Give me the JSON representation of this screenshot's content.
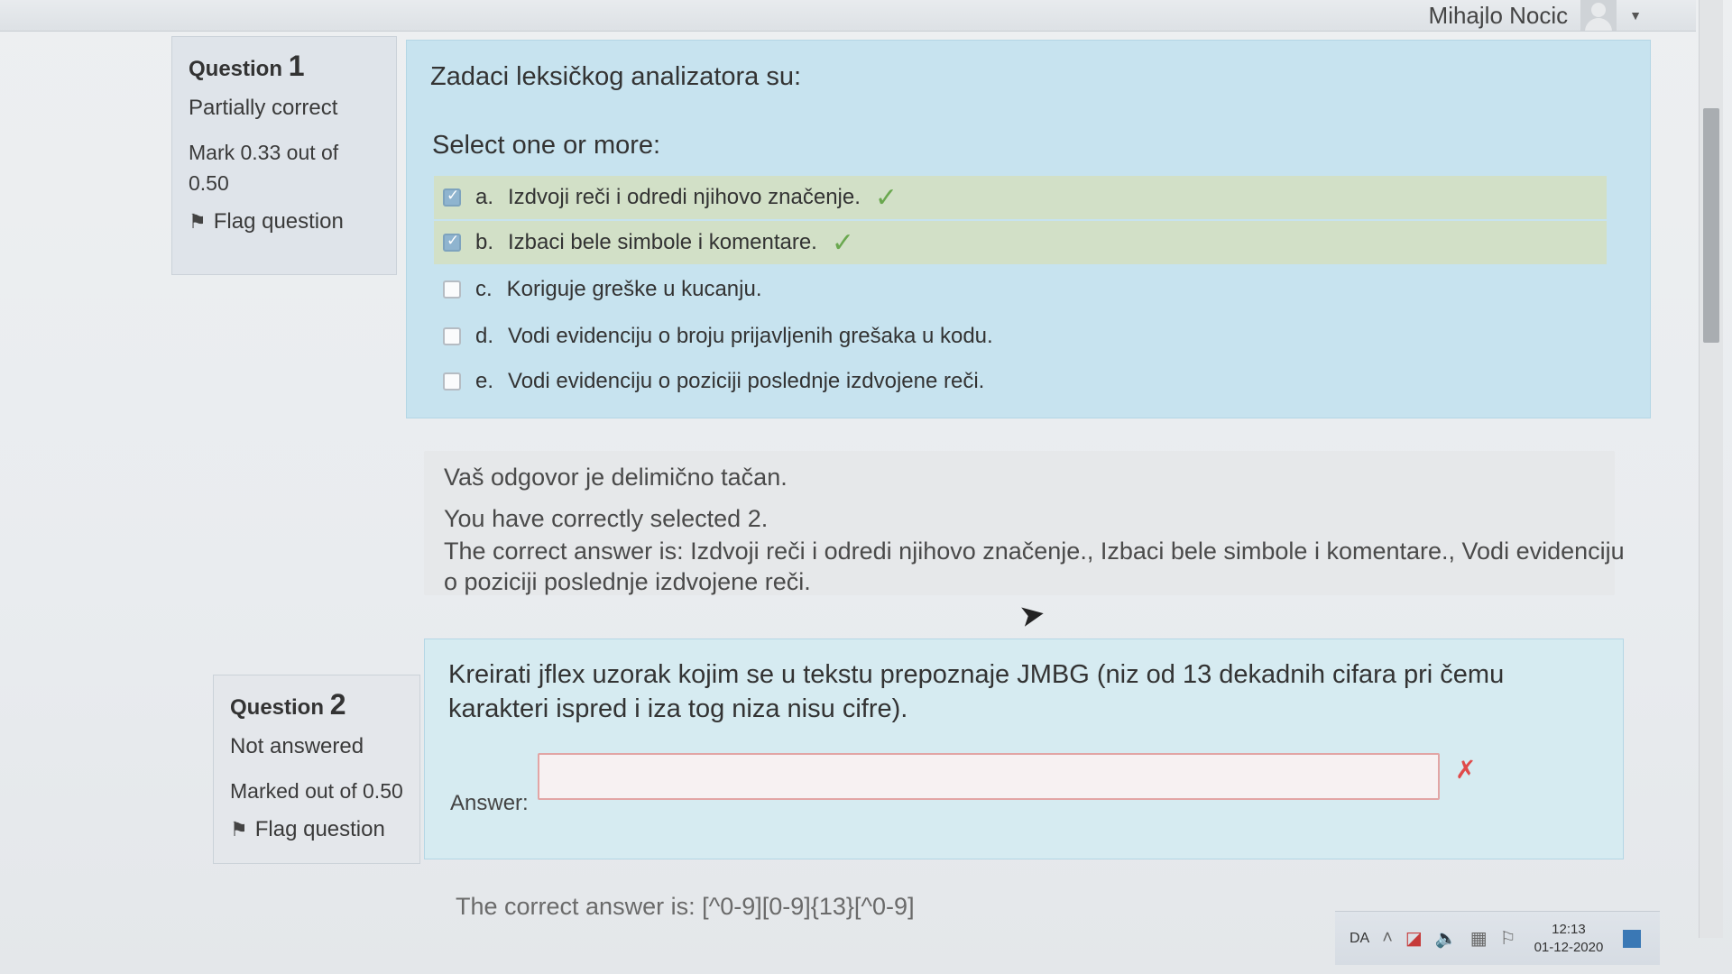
{
  "header": {
    "user_name": "Mihajlo Nocic"
  },
  "question1": {
    "label": "Question",
    "number": "1",
    "state": "Partially correct",
    "grade_line1": "Mark 0.33 out of",
    "grade_line2": "0.50",
    "flag_label": "Flag question",
    "prompt": "Zadaci leksičkog analizatora su:",
    "select_label": "Select one or more:",
    "options": [
      {
        "letter": "a.",
        "text": "Izdvoji reči i odredi njihovo značenje.",
        "checked": true,
        "correct": true
      },
      {
        "letter": "b.",
        "text": "Izbaci bele simbole i komentare.",
        "checked": true,
        "correct": true
      },
      {
        "letter": "c.",
        "text": "Koriguje greške u kucanju.",
        "checked": false,
        "correct": false
      },
      {
        "letter": "d.",
        "text": "Vodi evidenciju o broju prijavljenih grešaka u kodu.",
        "checked": false,
        "correct": false
      },
      {
        "letter": "e.",
        "text": "Vodi evidenciju o poziciji poslednje izdvojene reči.",
        "checked": false,
        "correct": false
      }
    ],
    "feedback": {
      "summary": "Vaš odgovor je delimično tačan.",
      "selected": "You have correctly selected 2.",
      "correct_answer_line1": "The correct answer is: Izdvoji reči i odredi njihovo značenje., Izbaci bele simbole i komentare., Vodi evidenciju",
      "correct_answer_line2": "o poziciji poslednje izdvojene reči."
    }
  },
  "question2": {
    "label": "Question",
    "number": "2",
    "state": "Not answered",
    "grade": "Marked out of 0.50",
    "flag_label": "Flag question",
    "prompt": "Kreirati jflex uzorak kojim se u tekstu prepoznaje JMBG (niz od 13 dekadnih cifara pri čemu karakteri ispred i iza tog niza nisu cifre).",
    "answer_label": "Answer:",
    "answer_value": "",
    "correct_answer": "The correct answer is: [^0-9][0-9]{13}[^0-9]"
  },
  "taskbar": {
    "language": "DA",
    "time": "12:13",
    "date": "01-12-2020"
  },
  "colors": {
    "question_bg": "#c7e3ef",
    "correct_row": "#d2e0c7",
    "tick": "#6aa84f",
    "wrong": "#e04a4a"
  }
}
